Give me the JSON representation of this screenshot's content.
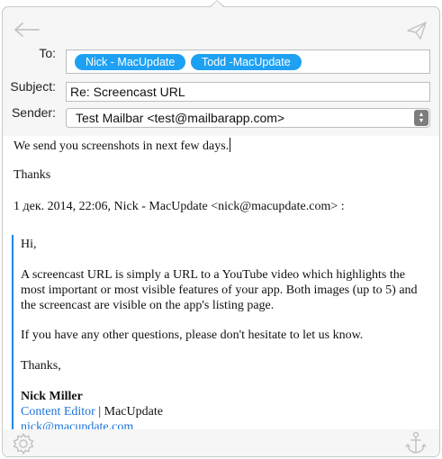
{
  "header": {
    "back_icon": "arrow-left-icon",
    "send_icon": "paper-plane-icon"
  },
  "to": {
    "label": "To:",
    "recipients": [
      "Nick - MacUpdate",
      "Todd -MacUpdate"
    ]
  },
  "subject": {
    "label": "Subject:",
    "value": "Re: Screencast URL"
  },
  "sender": {
    "label": "Sender:",
    "value": "Test Mailbar <test@mailbarapp.com>"
  },
  "body": {
    "line1": "We send you screenshots in next few days.",
    "line2": "Thanks",
    "reply_header": "1 дек. 2014, 22:06, Nick - MacUpdate <nick@macupdate.com> :",
    "quote": {
      "greeting": "Hi,",
      "para1_l1": "A screencast URL is simply a URL to a YouTube video which highlights the",
      "para1_l2": "most important or most visible features of your app. Both images (up to 5) and",
      "para1_l3": "the screencast are visible on the app's listing page.",
      "para2": "If you have any other questions, please don't hesitate to let us know.",
      "signoff": "Thanks,",
      "name": "Nick Miller",
      "role": "Content Editor",
      "separator": " | ",
      "company": "MacUpdate",
      "email": "nick@macupdate.com"
    }
  },
  "footer": {
    "settings_icon": "gear-icon",
    "attach_icon": "anchor-icon"
  },
  "colors": {
    "chip": "#1ea1f2",
    "quote_bar": "#1e88e5",
    "link": "#1a73d9"
  }
}
